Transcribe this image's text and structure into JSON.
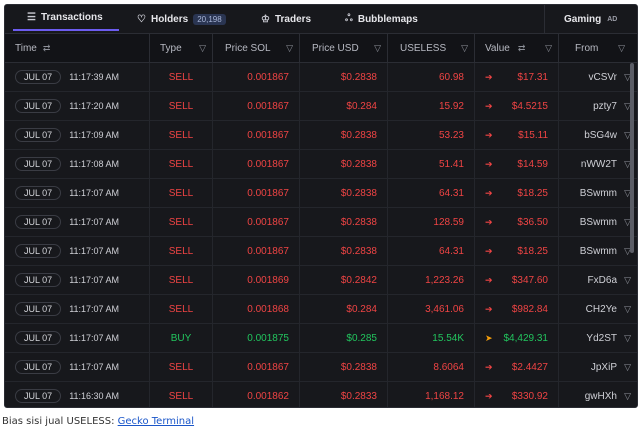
{
  "tabs": [
    {
      "label": "Transactions",
      "icon": "list-icon"
    },
    {
      "label": "Holders",
      "icon": "heart-icon",
      "badge": "20,198"
    },
    {
      "label": "Traders",
      "icon": "trophy-icon"
    },
    {
      "label": "Bubblemaps",
      "icon": "bubbles-icon"
    }
  ],
  "gaming": {
    "label": "Gaming",
    "ad": "AD"
  },
  "columns": {
    "time": "Time",
    "type": "Type",
    "price_sol": "Price SOL",
    "price_usd": "Price USD",
    "useless": "USELESS",
    "value": "Value",
    "from": "From"
  },
  "rows": [
    {
      "date": "JUL 07",
      "time": "11:17:39 AM",
      "type": "SELL",
      "price_sol": "0.001867",
      "price_usd": "$0.2838",
      "amount": "60.98",
      "value": "$17.31",
      "from": "vCSVr"
    },
    {
      "date": "JUL 07",
      "time": "11:17:20 AM",
      "type": "SELL",
      "price_sol": "0.001867",
      "price_usd": "$0.284",
      "amount": "15.92",
      "value": "$4.5215",
      "from": "pzty7"
    },
    {
      "date": "JUL 07",
      "time": "11:17:09 AM",
      "type": "SELL",
      "price_sol": "0.001867",
      "price_usd": "$0.2838",
      "amount": "53.23",
      "value": "$15.11",
      "from": "bSG4w"
    },
    {
      "date": "JUL 07",
      "time": "11:17:08 AM",
      "type": "SELL",
      "price_sol": "0.001867",
      "price_usd": "$0.2838",
      "amount": "51.41",
      "value": "$14.59",
      "from": "nWW2T"
    },
    {
      "date": "JUL 07",
      "time": "11:17:07 AM",
      "type": "SELL",
      "price_sol": "0.001867",
      "price_usd": "$0.2838",
      "amount": "64.31",
      "value": "$18.25",
      "from": "BSwmm"
    },
    {
      "date": "JUL 07",
      "time": "11:17:07 AM",
      "type": "SELL",
      "price_sol": "0.001867",
      "price_usd": "$0.2838",
      "amount": "128.59",
      "value": "$36.50",
      "from": "BSwmm"
    },
    {
      "date": "JUL 07",
      "time": "11:17:07 AM",
      "type": "SELL",
      "price_sol": "0.001867",
      "price_usd": "$0.2838",
      "amount": "64.31",
      "value": "$18.25",
      "from": "BSwmm"
    },
    {
      "date": "JUL 07",
      "time": "11:17:07 AM",
      "type": "SELL",
      "price_sol": "0.001869",
      "price_usd": "$0.2842",
      "amount": "1,223.26",
      "value": "$347.60",
      "from": "FxD6a"
    },
    {
      "date": "JUL 07",
      "time": "11:17:07 AM",
      "type": "SELL",
      "price_sol": "0.001868",
      "price_usd": "$0.284",
      "amount": "3,461.06",
      "value": "$982.84",
      "from": "CH2Ye"
    },
    {
      "date": "JUL 07",
      "time": "11:17:07 AM",
      "type": "BUY",
      "price_sol": "0.001875",
      "price_usd": "$0.285",
      "amount": "15.54K",
      "value": "$4,429.31",
      "from": "Yd2ST"
    },
    {
      "date": "JUL 07",
      "time": "11:17:07 AM",
      "type": "SELL",
      "price_sol": "0.001867",
      "price_usd": "$0.2838",
      "amount": "8.6064",
      "value": "$2.4427",
      "from": "JpXiP"
    },
    {
      "date": "JUL 07",
      "time": "11:16:30 AM",
      "type": "SELL",
      "price_sol": "0.001862",
      "price_usd": "$0.2833",
      "amount": "1,168.12",
      "value": "$330.92",
      "from": "gwHXh"
    }
  ],
  "caption": {
    "text": "Bias sisi jual USELESS: ",
    "link": "Gecko Terminal"
  },
  "colors": {
    "sell": "#ef4444",
    "buy": "#22c55e",
    "accent": "#6c5cf0",
    "background": "#17181c"
  }
}
